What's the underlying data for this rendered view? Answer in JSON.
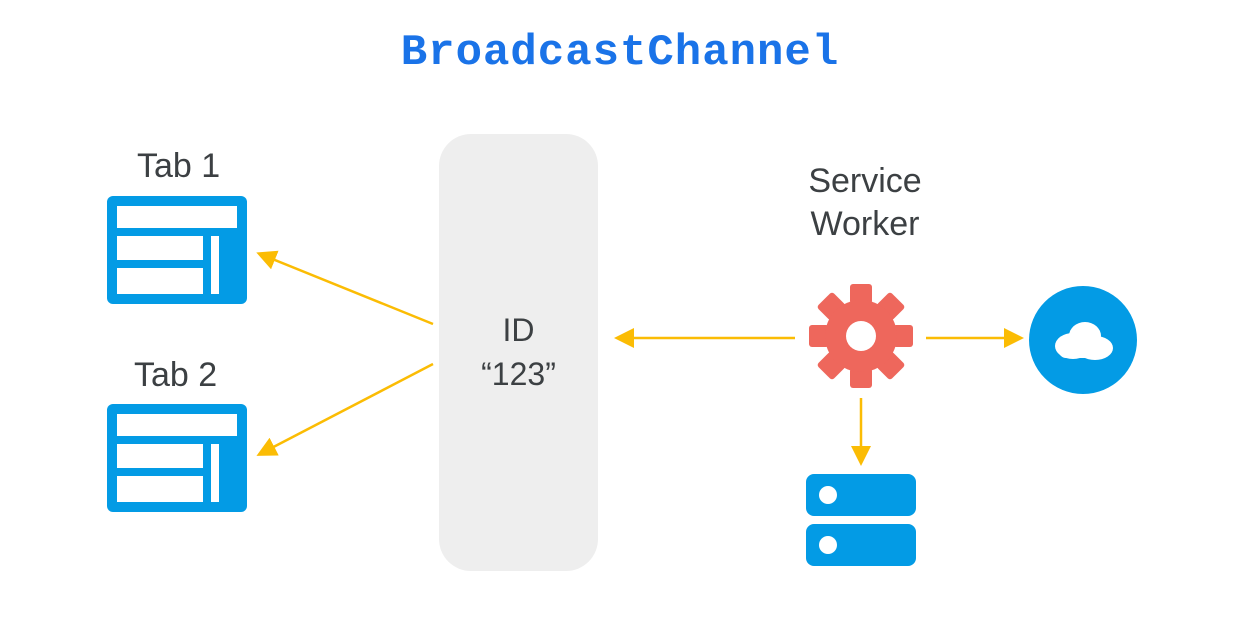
{
  "title": "BroadcastChannel",
  "tabs": [
    {
      "label": "Tab 1"
    },
    {
      "label": "Tab 2"
    }
  ],
  "channel": {
    "line1": "ID",
    "line2": "“123”"
  },
  "service_worker_label_line1": "Service",
  "service_worker_label_line2": "Worker",
  "icons": {
    "tab": "browser-window-icon",
    "gear": "gear-icon",
    "server": "server-icon",
    "cloud": "cloud-icon"
  },
  "colors": {
    "brand_blue": "#1a73e8",
    "icon_blue": "#039be5",
    "gear_red": "#ee675c",
    "arrow": "#fbbc04",
    "channel_bg": "#eeeeee",
    "text": "#3c4043"
  },
  "arrows": [
    {
      "from": "channel",
      "to": "tab1"
    },
    {
      "from": "channel",
      "to": "tab2"
    },
    {
      "from": "service-worker",
      "to": "channel"
    },
    {
      "from": "service-worker",
      "to": "cloud"
    },
    {
      "from": "service-worker",
      "to": "server"
    }
  ]
}
